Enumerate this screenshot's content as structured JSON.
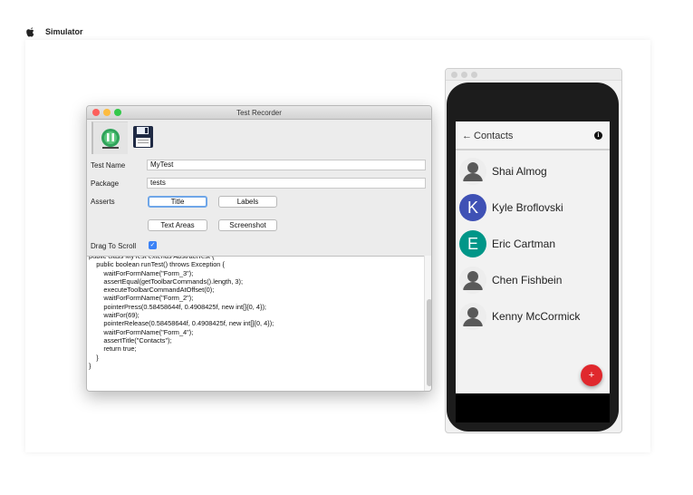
{
  "menubar": {
    "app_name": "Simulator"
  },
  "recorder": {
    "window_title": "Test Recorder",
    "test_name_label": "Test Name",
    "test_name_value": "MyTest",
    "package_label": "Package",
    "package_value": "tests",
    "asserts_label": "Asserts",
    "buttons": {
      "title": "Title",
      "labels": "Labels",
      "text_areas": "Text Areas",
      "screenshot": "Screenshot"
    },
    "drag_to_scroll_label": "Drag To Scroll",
    "drag_to_scroll_checked": true,
    "code_lines": [
      "public class MyTest extends AbstractTest {",
      "    public boolean runTest() throws Exception {",
      "        waitForFormName(\"Form_3\");",
      "        assertEqual(getToolbarCommands().length, 3);",
      "        executeToolbarCommandAtOffset(0);",
      "        waitForFormName(\"Form_2\");",
      "        pointerPress(0.58458644f, 0.4908425f, new int[]{0, 4});",
      "        waitFor(69);",
      "        pointerRelease(0.58458644f, 0.4908425f, new int[]{0, 4});",
      "        waitForFormName(\"Form_4\");",
      "        assertTitle(\"Contacts\");",
      "        return true;",
      "    }",
      "}"
    ]
  },
  "phone": {
    "title": "Contacts",
    "back_glyph": "←",
    "contacts": [
      {
        "name": "Shai Almog",
        "initial": "",
        "color": ""
      },
      {
        "name": "Kyle Broflovski",
        "initial": "K",
        "color": "#3f51b5"
      },
      {
        "name": "Eric Cartman",
        "initial": "E",
        "color": "#009688"
      },
      {
        "name": "Chen Fishbein",
        "initial": "",
        "color": ""
      },
      {
        "name": "Kenny McCormick",
        "initial": "",
        "color": ""
      }
    ],
    "fab_glyph": "+"
  }
}
